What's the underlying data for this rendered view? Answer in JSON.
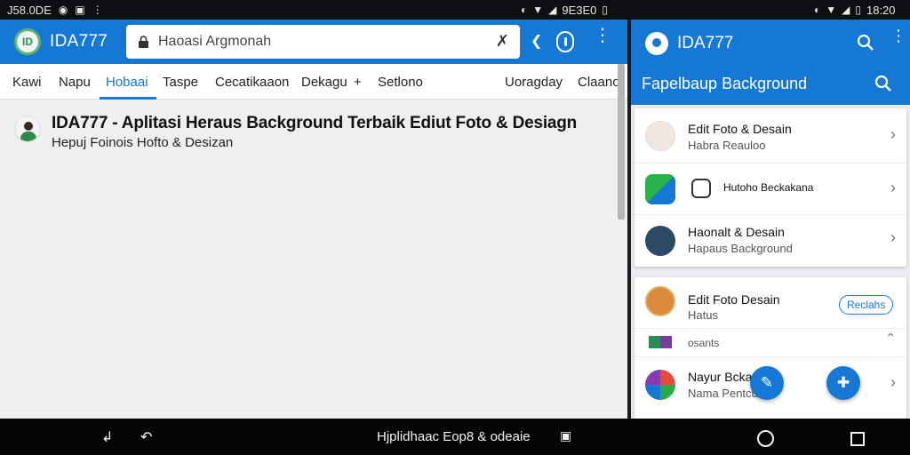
{
  "status": {
    "left_text": "J58.0DE",
    "right_time_a": "9E3E0",
    "right_time_b": "18:20"
  },
  "browser": {
    "app_title": "IDA777",
    "url_text": "Haoasi Argmonah",
    "tabs": [
      {
        "label": "Kawi"
      },
      {
        "label": "Napu"
      },
      {
        "label": "Hobaai"
      },
      {
        "label": "Taspe"
      },
      {
        "label": "Cecatikaaon"
      },
      {
        "label": "Dekagu"
      },
      {
        "label": "+"
      },
      {
        "label": "Setlono"
      },
      {
        "label": "Uoragday"
      },
      {
        "label": "Claano"
      }
    ],
    "result": {
      "title": "IDA777 - Aplitasi Heraus Background Terbaik Ediut Foto & Desiagn",
      "subtitle": "Hepuj Foinois Hofto & Desizan"
    }
  },
  "side_app": {
    "title": "IDA777",
    "subtitle": "Fapelbaup Background",
    "card1": [
      {
        "title": "Edit Foto & Desain",
        "sub": "Habra Reauloo"
      },
      {
        "title": "Hutoho Beckakana",
        "sub": ""
      },
      {
        "title": "Haonalt & Desain",
        "sub": "Hapaus Background"
      }
    ],
    "card2": [
      {
        "title": "Edit Foto Desain",
        "sub": "Hatus",
        "badge": "Reclahs"
      },
      {
        "title": "",
        "sub": "osants"
      },
      {
        "title": "Nayur Bcka",
        "sub": "Nama Pentcu"
      }
    ]
  },
  "navbar": {
    "center_text": "Hjplidhaac Eop8 & odeaie"
  },
  "colors": {
    "accent": "#1478d4",
    "statusbar": "#0d0f12"
  }
}
